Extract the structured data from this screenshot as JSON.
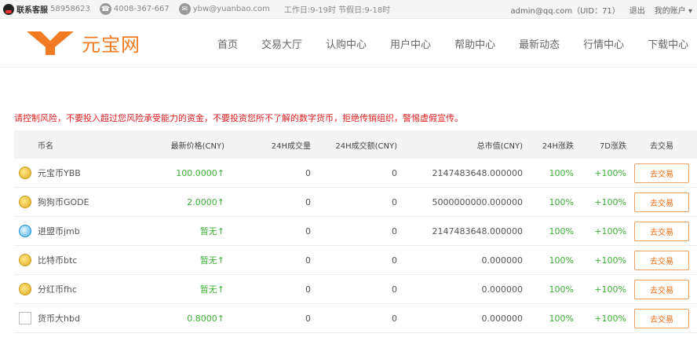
{
  "topbar": {
    "kefu_label": "联系客服",
    "kefu_number": "58958623",
    "phone": "4008-367-667",
    "email": "ybw@yuanbao.com",
    "hours": "工作日:9-19时 节假日:9-18时",
    "account": "admin@qq.com（UID：71）",
    "logout": "退出",
    "my_account": "我的账户 ▾",
    "phone_icon": "phone-icon",
    "email_icon": "email-icon",
    "qq_icon": "qq-icon"
  },
  "header": {
    "logo_text": "元宝网",
    "brand_color": "#f07b22",
    "nav": [
      "首页",
      "交易大厅",
      "认购中心",
      "用户中心",
      "帮助中心",
      "最新动态",
      "行情中心",
      "下载中心"
    ]
  },
  "warning": "请控制风险，不要投入超过您风险承受能力的资金，不要投资您所不了解的数字货币，拒绝传销组织，警惕虚假宣传。",
  "table": {
    "headers": {
      "name": "币名",
      "price": "最新价格(CNY)",
      "volume": "24H成交量",
      "amount": "24H成交额(CNY)",
      "cap": "总市值(CNY)",
      "change24": "24H涨跌",
      "change7": "7D涨跌",
      "action": "去交易"
    },
    "rows": [
      {
        "icon": "gold-coin-icon",
        "name": "元宝币YBB",
        "price": "100.0000",
        "arrow": "↑",
        "volume": "0",
        "amount": "0",
        "cap": "2147483648.000000",
        "change24": "100%",
        "change7": "+100%",
        "action": "去交易"
      },
      {
        "icon": "gold-coin-icon",
        "name": "狗狗币GODE",
        "price": "2.0000",
        "arrow": "↑",
        "volume": "0",
        "amount": "0",
        "cap": "5000000000.000000",
        "change24": "100%",
        "change7": "+100%",
        "action": "去交易"
      },
      {
        "icon": "blue-coin-icon",
        "name": "进盟币jmb",
        "price": "暂无",
        "arrow": "↑",
        "volume": "0",
        "amount": "0",
        "cap": "2147483648.000000",
        "change24": "100%",
        "change7": "+100%",
        "action": "去交易"
      },
      {
        "icon": "gold-coin-icon",
        "name": "比特币btc",
        "price": "暂无",
        "arrow": "↑",
        "volume": "0",
        "amount": "0",
        "cap": "0.000000",
        "change24": "100%",
        "change7": "+100%",
        "action": "去交易"
      },
      {
        "icon": "gold-coin-icon",
        "name": "分红币fhc",
        "price": "暂无",
        "arrow": "↑",
        "volume": "0",
        "amount": "0",
        "cap": "0.000000",
        "change24": "100%",
        "change7": "+100%",
        "action": "去交易"
      },
      {
        "icon": "blank-coin-icon",
        "name": "货币大hbd",
        "price": "0.8000",
        "arrow": "↑",
        "volume": "0",
        "amount": "0",
        "cap": "0.000000",
        "change24": "100%",
        "change7": "+100%",
        "action": "去交易"
      }
    ]
  }
}
